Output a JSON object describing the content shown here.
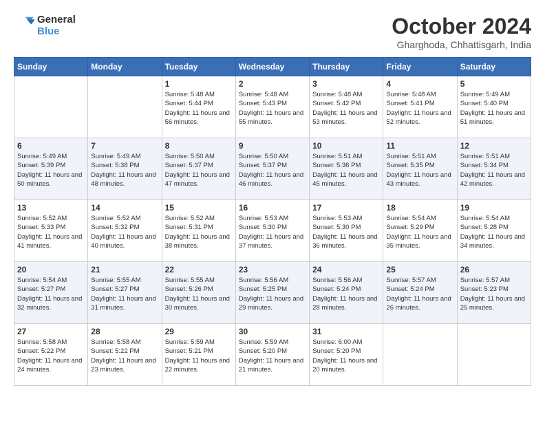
{
  "header": {
    "logo_line1": "General",
    "logo_line2": "Blue",
    "month_title": "October 2024",
    "location": "Gharghoda, Chhattisgarh, India"
  },
  "days_of_week": [
    "Sunday",
    "Monday",
    "Tuesday",
    "Wednesday",
    "Thursday",
    "Friday",
    "Saturday"
  ],
  "weeks": [
    [
      {
        "day": "",
        "details": ""
      },
      {
        "day": "",
        "details": ""
      },
      {
        "day": "1",
        "details": "Sunrise: 5:48 AM\nSunset: 5:44 PM\nDaylight: 11 hours and 56 minutes."
      },
      {
        "day": "2",
        "details": "Sunrise: 5:48 AM\nSunset: 5:43 PM\nDaylight: 11 hours and 55 minutes."
      },
      {
        "day": "3",
        "details": "Sunrise: 5:48 AM\nSunset: 5:42 PM\nDaylight: 11 hours and 53 minutes."
      },
      {
        "day": "4",
        "details": "Sunrise: 5:48 AM\nSunset: 5:41 PM\nDaylight: 11 hours and 52 minutes."
      },
      {
        "day": "5",
        "details": "Sunrise: 5:49 AM\nSunset: 5:40 PM\nDaylight: 11 hours and 51 minutes."
      }
    ],
    [
      {
        "day": "6",
        "details": "Sunrise: 5:49 AM\nSunset: 5:39 PM\nDaylight: 11 hours and 50 minutes."
      },
      {
        "day": "7",
        "details": "Sunrise: 5:49 AM\nSunset: 5:38 PM\nDaylight: 11 hours and 48 minutes."
      },
      {
        "day": "8",
        "details": "Sunrise: 5:50 AM\nSunset: 5:37 PM\nDaylight: 11 hours and 47 minutes."
      },
      {
        "day": "9",
        "details": "Sunrise: 5:50 AM\nSunset: 5:37 PM\nDaylight: 11 hours and 46 minutes."
      },
      {
        "day": "10",
        "details": "Sunrise: 5:51 AM\nSunset: 5:36 PM\nDaylight: 11 hours and 45 minutes."
      },
      {
        "day": "11",
        "details": "Sunrise: 5:51 AM\nSunset: 5:35 PM\nDaylight: 11 hours and 43 minutes."
      },
      {
        "day": "12",
        "details": "Sunrise: 5:51 AM\nSunset: 5:34 PM\nDaylight: 11 hours and 42 minutes."
      }
    ],
    [
      {
        "day": "13",
        "details": "Sunrise: 5:52 AM\nSunset: 5:33 PM\nDaylight: 11 hours and 41 minutes."
      },
      {
        "day": "14",
        "details": "Sunrise: 5:52 AM\nSunset: 5:32 PM\nDaylight: 11 hours and 40 minutes."
      },
      {
        "day": "15",
        "details": "Sunrise: 5:52 AM\nSunset: 5:31 PM\nDaylight: 11 hours and 38 minutes."
      },
      {
        "day": "16",
        "details": "Sunrise: 5:53 AM\nSunset: 5:30 PM\nDaylight: 11 hours and 37 minutes."
      },
      {
        "day": "17",
        "details": "Sunrise: 5:53 AM\nSunset: 5:30 PM\nDaylight: 11 hours and 36 minutes."
      },
      {
        "day": "18",
        "details": "Sunrise: 5:54 AM\nSunset: 5:29 PM\nDaylight: 11 hours and 35 minutes."
      },
      {
        "day": "19",
        "details": "Sunrise: 5:54 AM\nSunset: 5:28 PM\nDaylight: 11 hours and 34 minutes."
      }
    ],
    [
      {
        "day": "20",
        "details": "Sunrise: 5:54 AM\nSunset: 5:27 PM\nDaylight: 11 hours and 32 minutes."
      },
      {
        "day": "21",
        "details": "Sunrise: 5:55 AM\nSunset: 5:27 PM\nDaylight: 11 hours and 31 minutes."
      },
      {
        "day": "22",
        "details": "Sunrise: 5:55 AM\nSunset: 5:26 PM\nDaylight: 11 hours and 30 minutes."
      },
      {
        "day": "23",
        "details": "Sunrise: 5:56 AM\nSunset: 5:25 PM\nDaylight: 11 hours and 29 minutes."
      },
      {
        "day": "24",
        "details": "Sunrise: 5:56 AM\nSunset: 5:24 PM\nDaylight: 11 hours and 28 minutes."
      },
      {
        "day": "25",
        "details": "Sunrise: 5:57 AM\nSunset: 5:24 PM\nDaylight: 11 hours and 26 minutes."
      },
      {
        "day": "26",
        "details": "Sunrise: 5:57 AM\nSunset: 5:23 PM\nDaylight: 11 hours and 25 minutes."
      }
    ],
    [
      {
        "day": "27",
        "details": "Sunrise: 5:58 AM\nSunset: 5:22 PM\nDaylight: 11 hours and 24 minutes."
      },
      {
        "day": "28",
        "details": "Sunrise: 5:58 AM\nSunset: 5:22 PM\nDaylight: 11 hours and 23 minutes."
      },
      {
        "day": "29",
        "details": "Sunrise: 5:59 AM\nSunset: 5:21 PM\nDaylight: 11 hours and 22 minutes."
      },
      {
        "day": "30",
        "details": "Sunrise: 5:59 AM\nSunset: 5:20 PM\nDaylight: 11 hours and 21 minutes."
      },
      {
        "day": "31",
        "details": "Sunrise: 6:00 AM\nSunset: 5:20 PM\nDaylight: 11 hours and 20 minutes."
      },
      {
        "day": "",
        "details": ""
      },
      {
        "day": "",
        "details": ""
      }
    ]
  ]
}
